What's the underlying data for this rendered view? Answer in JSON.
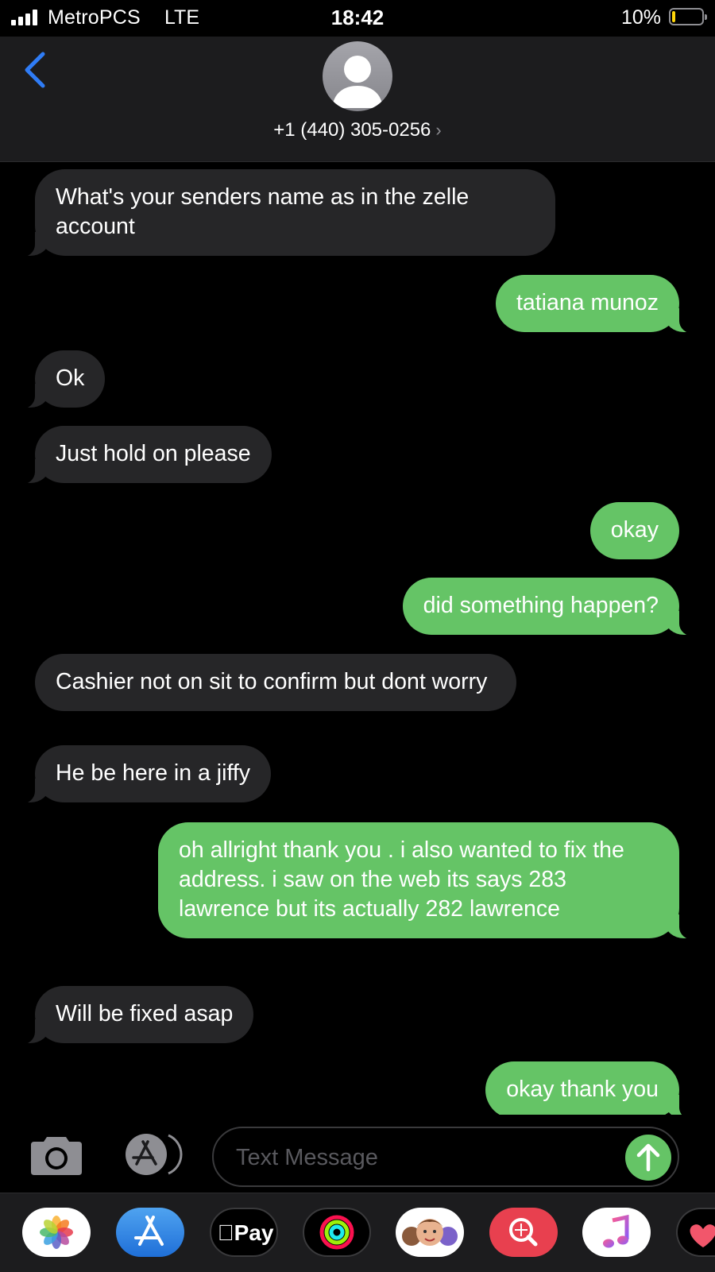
{
  "status_bar": {
    "carrier": "MetroPCS",
    "network": "LTE",
    "time": "18:42",
    "battery_percent": "10%",
    "battery_level": 0.1
  },
  "header": {
    "contact": "+1 (440) 305-0256",
    "chevron": "›",
    "back_icon": "chevron-left-icon",
    "avatar_icon": "person-silhouette-icon"
  },
  "messages": [
    {
      "direction": "incoming",
      "text": "What's your senders name as in the zelle account"
    },
    {
      "direction": "outgoing",
      "text": "tatiana munoz"
    },
    {
      "direction": "incoming",
      "text": "Ok"
    },
    {
      "direction": "incoming",
      "text": "Just hold on please"
    },
    {
      "direction": "outgoing",
      "text": "okay"
    },
    {
      "direction": "outgoing",
      "text": "did something happen?"
    },
    {
      "direction": "incoming",
      "text": "Cashier not on sit to confirm but dont worry"
    },
    {
      "direction": "incoming",
      "text": "He be here in a jiffy"
    },
    {
      "direction": "outgoing",
      "text": "oh allright thank you . i also wanted to fix the address. i saw on the web its says 283 lawrence but its actually 282 lawrence"
    },
    {
      "direction": "incoming",
      "text": "Will be fixed asap"
    },
    {
      "direction": "outgoing",
      "text": "okay thank you"
    }
  ],
  "compose": {
    "placeholder": "Text Message",
    "value": "",
    "camera_icon": "camera-icon",
    "appstore_icon": "app-store-icon",
    "send_icon": "arrow-up-icon"
  },
  "app_drawer": {
    "apps": [
      {
        "name": "photos-icon"
      },
      {
        "name": "app-store-icon"
      },
      {
        "name": "apple-pay-icon",
        "label": "Pay"
      },
      {
        "name": "activity-icon"
      },
      {
        "name": "memoji-icon"
      },
      {
        "name": "image-search-icon"
      },
      {
        "name": "music-icon"
      },
      {
        "name": "heart-icon"
      }
    ]
  },
  "colors": {
    "incoming_bubble": "#262628",
    "outgoing_bubble": "#65c466",
    "accent_blue": "#2f7cf6",
    "header_bg": "#1c1c1e"
  }
}
